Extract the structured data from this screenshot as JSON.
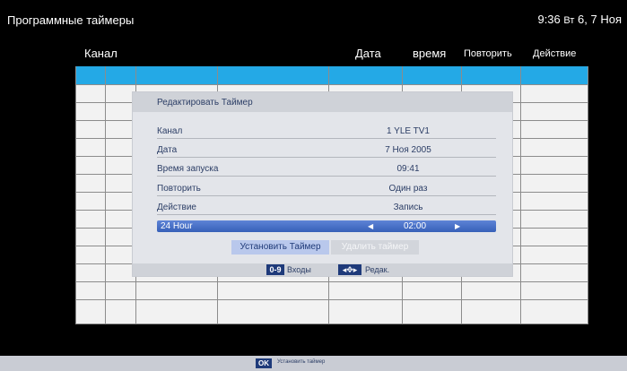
{
  "header": {
    "title": "Программные таймеры",
    "clock_time": "9:36",
    "clock_day": "Вт",
    "clock_date": "6, 7 Ноя"
  },
  "columns": {
    "channel": "Канал",
    "date": "Дата",
    "time": "время",
    "repeat": "Повторить",
    "action": "Действие"
  },
  "dialog": {
    "title": "Редактировать Таймер",
    "fields": [
      {
        "label": "Канал",
        "value": "1 YLE TV1"
      },
      {
        "label": "Дата",
        "value": "7 Ноя 2005"
      },
      {
        "label": "Время запуска",
        "value": "09:41"
      },
      {
        "label": "Повторить",
        "value": "Один раз"
      },
      {
        "label": "Действие",
        "value": "Запись"
      }
    ],
    "selected_field": {
      "label": "24 Hour",
      "value": "02:00"
    },
    "buttons": {
      "set_timer": "Установить Таймер",
      "delete_timer": "Удалить таймер"
    },
    "footer": {
      "key_digits": "0-9",
      "key_digits_text": "Входы",
      "key_nav_text": "Редак."
    }
  },
  "bottom_bar": {
    "ok_label": "OK",
    "ok_text": "Установить таймер"
  },
  "colors": {
    "highlight_row": "#24a9e6",
    "selected_field": "#3f68c0",
    "badge": "#1e3a7a"
  }
}
